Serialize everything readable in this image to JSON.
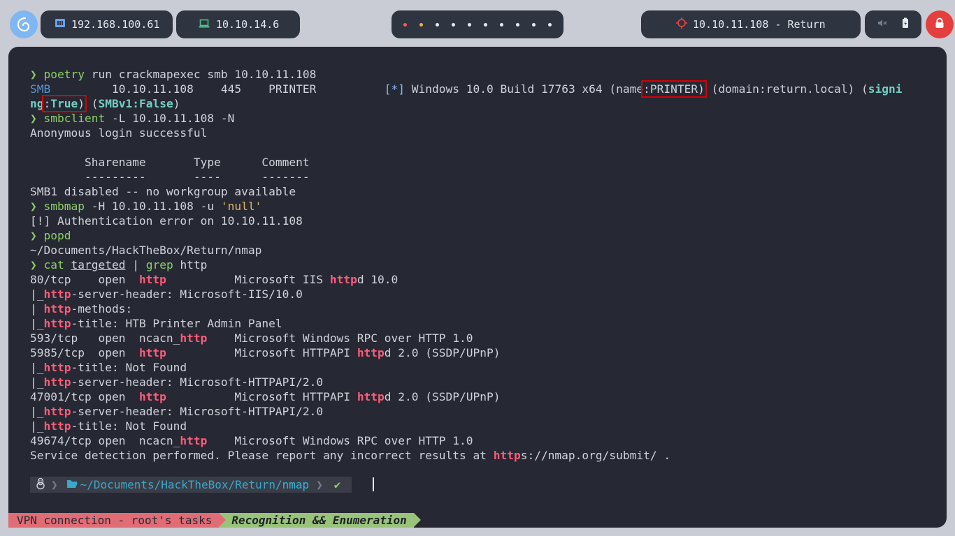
{
  "topbar": {
    "host_ip": "192.168.100.61",
    "vpn_ip": "10.10.14.6",
    "target": "10.10.11.108 - Return",
    "workspaces": 10,
    "colors": {
      "ws_active": "#ff5c5c",
      "ws_occupied": "#f0b33a",
      "ws_idle": "#e6e9ef"
    }
  },
  "terminal": {
    "l1_arrow": "❯ ",
    "l1_cmd": "poetry",
    "l1_rest": " run crackmapexec smb 10.10.11.108",
    "l2_smb": "SMB",
    "l2_mid": "         10.10.11.108    445    PRINTER          ",
    "l2_star": "[*]",
    "l2_info": " Windows 10.0 Build 17763 x64 (name",
    "l2_name": ":PRINTER)",
    "l2_domain": " (domain:return.local) (",
    "l2_sign": "signi",
    "l3_sign": "ng",
    "l3_true": ":True)",
    "l3_space": " (",
    "l3_smbv1": "SMBv1:False",
    "l3_close": ")",
    "l4_arrow": "❯ ",
    "l4_cmd": "smbclient",
    "l4_rest": " -L 10.10.11.108 -N",
    "l5": "Anonymous login successful",
    "l7": "        Sharename       Type      Comment",
    "l8": "        ---------       ----      -------",
    "l9": "SMB1 disabled -- no workgroup available",
    "l10_arrow": "❯ ",
    "l10_cmd": "smbmap",
    "l10_rest": " -H 10.10.11.108 -u ",
    "l10_str": "'null'",
    "l11": "[!] Authentication error on 10.10.11.108",
    "l12_arrow": "❯ ",
    "l12_cmd": "popd",
    "l13": "~/Documents/HackTheBox/Return/nmap",
    "l14_arrow": "❯ ",
    "l14_cat": "cat",
    "l14_sp": " ",
    "l14_file": "targeted",
    "l14_pipe": " | ",
    "l14_grep": "grep",
    "l14_rest": " http",
    "l15a": "80/tcp    open  ",
    "l15h": "http",
    "l15b": "          Microsoft IIS ",
    "l15h2": "http",
    "l15c": "d 10.0",
    "l16a": "|_",
    "l16h": "http",
    "l16b": "-server-header: Microsoft-IIS/10.0",
    "l17a": "| ",
    "l17h": "http",
    "l17b": "-methods:",
    "l18a": "|_",
    "l18h": "http",
    "l18b": "-title: HTB Printer Admin Panel",
    "l19a": "593/tcp   open  ncacn_",
    "l19h": "http",
    "l19b": "    Microsoft Windows RPC over HTTP 1.0",
    "l20a": "5985/tcp  open  ",
    "l20h": "http",
    "l20b": "          Microsoft HTTPAPI ",
    "l20h2": "http",
    "l20c": "d 2.0 (SSDP/UPnP)",
    "l21a": "|_",
    "l21h": "http",
    "l21b": "-title: Not Found",
    "l22a": "|_",
    "l22h": "http",
    "l22b": "-server-header: Microsoft-HTTPAPI/2.0",
    "l23a": "47001/tcp open  ",
    "l23h": "http",
    "l23b": "          Microsoft HTTPAPI ",
    "l23h2": "http",
    "l23c": "d 2.0 (SSDP/UPnP)",
    "l24a": "|_",
    "l24h": "http",
    "l24b": "-server-header: Microsoft-HTTPAPI/2.0",
    "l25a": "|_",
    "l25h": "http",
    "l25b": "-title: Not Found",
    "l26a": "49674/tcp open  ncacn_",
    "l26h": "http",
    "l26b": "    Microsoft Windows RPC over HTTP 1.0",
    "l27a": "Service detection performed. Please report any incorrect results at ",
    "l27h": "http",
    "l27b": "s://nmap.org/submit/ ."
  },
  "prompt": {
    "path": "~/Documents/HackTheBox/Return/",
    "dir": "nmap",
    "ok": "✔"
  },
  "statusbar": {
    "session": "VPN connection - root's tasks",
    "window": "Recognition && Enumeration"
  }
}
